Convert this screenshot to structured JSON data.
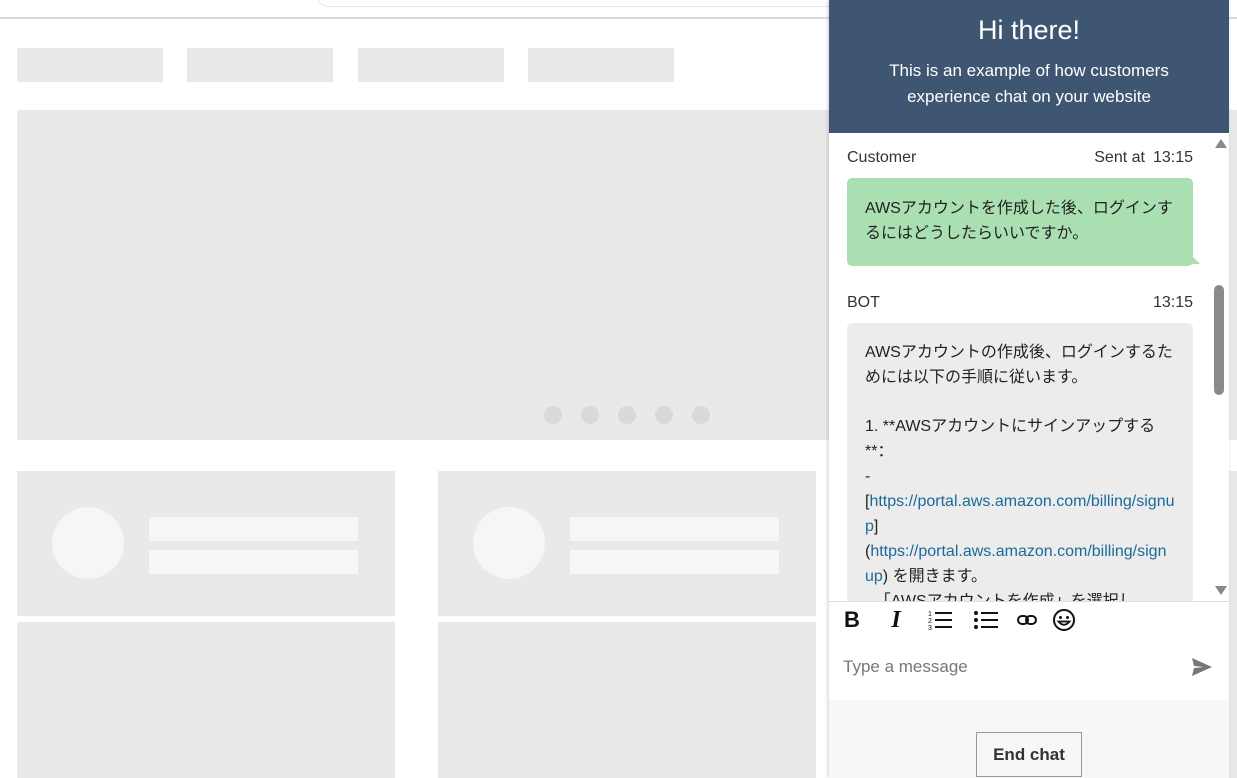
{
  "chat": {
    "header": {
      "title": "Hi there!",
      "subtitle": "This is an example of how customers experience chat on your website"
    },
    "messages": [
      {
        "sender": "Customer",
        "sent_label": "Sent at",
        "time": "13:15",
        "text": "AWSアカウントを作成した後、ログインするにはどうしたらいいですか。"
      },
      {
        "sender": "BOT",
        "time": "13:15",
        "line1": "AWSアカウントの作成後、ログインするためには以下の手順に従います。",
        "line2": "1. **AWSアカウントにサインアップする**：",
        "line3": "-",
        "bracket_open": "[",
        "link_url": "https://portal.aws.amazon.com/billing/signup",
        "bracket_close": "]",
        "paren_open": "(",
        "paren_close": ")",
        "after_link": " を開きます。",
        "line_cut": "「AWSアカウントを作成」を選択し"
      }
    ],
    "toolbar": {
      "bold_label": "B",
      "italic_label": "I"
    },
    "composer": {
      "placeholder": "Type a message"
    },
    "end_chat_label": "End chat"
  }
}
